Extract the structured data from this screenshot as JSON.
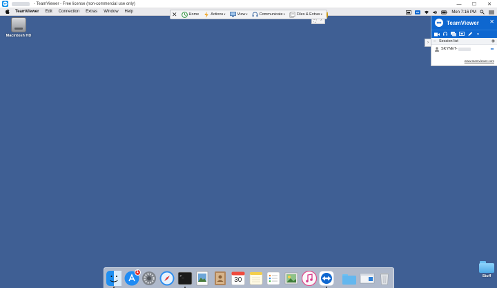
{
  "window": {
    "title": "- TeamViewer - Free license (non-commercial use only)",
    "controls": {
      "minimize": "—",
      "maximize": "☐",
      "close": "✕"
    }
  },
  "menubar": {
    "apple": "",
    "app_name": "TeamViewer",
    "items": [
      "Edit",
      "Connection",
      "Extras",
      "Window",
      "Help"
    ],
    "clock": "Mon 7:16 PM"
  },
  "toolbar": {
    "home": "Home",
    "actions": "Actions",
    "view": "View",
    "communicate": "Communicate",
    "files": "Files & Extras",
    "caret": "▾"
  },
  "desktop": {
    "hd_label": "Macintosh HD",
    "stuff_label": "Stuff",
    "background": "#3f5f94"
  },
  "panel": {
    "brand": "TeamViewer",
    "session_list_title": "Session list",
    "session_name": "SKYNET-",
    "link": "www.teamviewer.com",
    "accent": "#0e67d0"
  },
  "dock": {
    "appstore_badge": "1",
    "calendar_day": "30"
  }
}
